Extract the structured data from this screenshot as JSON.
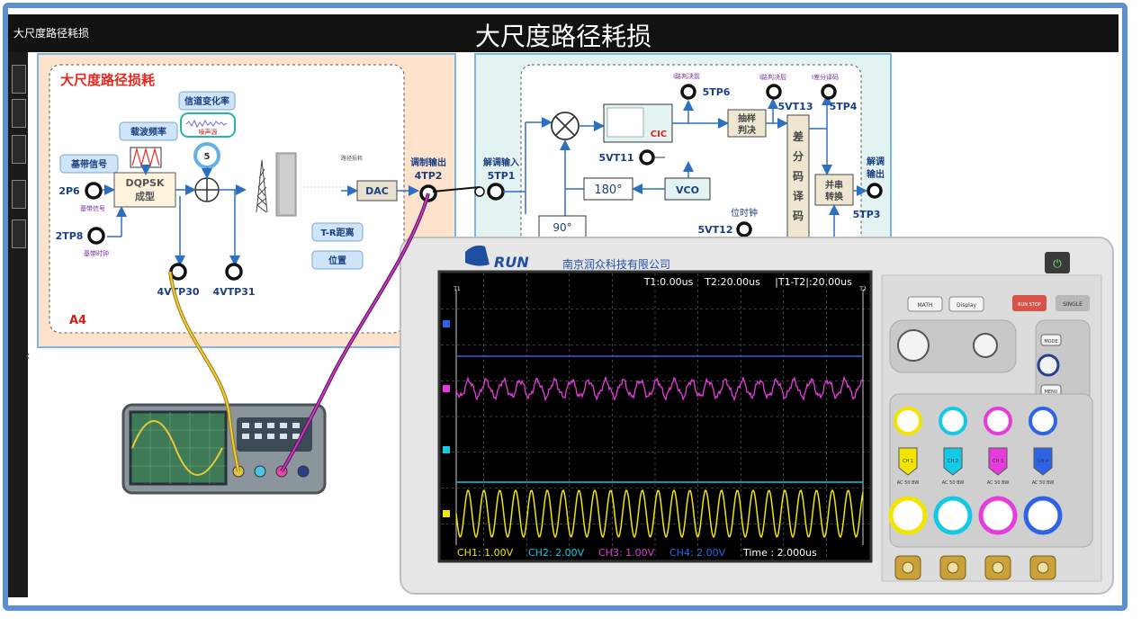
{
  "window": {
    "title_left": "大尺度路径耗损",
    "title_center": "大尺度路径耗损"
  },
  "panel_a4": {
    "heading": "大尺度路径损耗",
    "tag": "A4",
    "label_baseband": "基带信号",
    "label_carrier": "载波频率",
    "label_channel": "信道变化率",
    "label_noise": "噪声源",
    "noise_level": "5",
    "mod_line1": "DQPSK",
    "mod_line2": "成型",
    "tp_2p6": "2P6",
    "tp_2p6_sub": "基带信号",
    "tp_2tp8": "2TP8",
    "tp_2tp8_sub": "基带时钟",
    "tp_4vtp30": "4VTP30",
    "tp_4vtp31": "4VTP31",
    "path_loss_small": "路径损耗",
    "dac": "DAC",
    "mod_out_label": "调制输出",
    "tp_4tp2": "4TP2",
    "btn_tr": "T-R距离",
    "btn_pos": "位置"
  },
  "panel_demod": {
    "demod_in_label": "解调输入",
    "tp_5tp1": "5TP1",
    "cic": "CIC",
    "lbl_pre": "I路判决前",
    "tp_5tp6": "5TP6",
    "lbl_post": "I路判决后",
    "tp_5vt13": "5VT13",
    "lbl_diff": "I差分译码",
    "tp_5tp4": "5TP4",
    "sample_line1": "抽样",
    "sample_line2": "判决",
    "diff_decoder": "差分码译码",
    "ps_line1": "并串",
    "ps_line2": "转换",
    "demod_out_line1": "解调",
    "demod_out_line2": "输出",
    "tp_5tp3": "5TP3",
    "tp_5vt11": "5VT11",
    "phase180": "180°",
    "vco": "VCO",
    "phase90": "90°",
    "bit_clock": "位时钟",
    "tp_5vt12": "5VT12"
  },
  "scope": {
    "brand": "RUN",
    "company": "南京润众科技有限公司",
    "t1": "T1:0.00us",
    "t2": "T2:20.00us",
    "dt": "|T1-T2|:20.00us",
    "ch1": "CH1:  1.00V",
    "ch2": "CH2:  2.00V",
    "ch3": "CH3:  1.00V",
    "ch4": "CH4:  2.00V",
    "time": "Time : 2.000us",
    "marker_t1": "T1",
    "marker_t2": "T2",
    "btn_math": "MATH",
    "btn_display": "Display",
    "btn_run": "RUN STOP",
    "btn_single": "SINGLE",
    "btn_mode": "MODE",
    "btn_menu": "MENU",
    "ch_buttons": [
      "CH 1",
      "CH 2",
      "CH 3",
      "CH 4"
    ],
    "coupling": "AC  50  BW",
    "colors": {
      "ch1": "#f2e600",
      "ch2": "#14c8e6",
      "ch3": "#e63cdc",
      "ch4": "#2f63e6"
    }
  },
  "icons": [
    "power-icon",
    "probe-connector-icon",
    "antenna-tower-icon",
    "building-icon"
  ]
}
